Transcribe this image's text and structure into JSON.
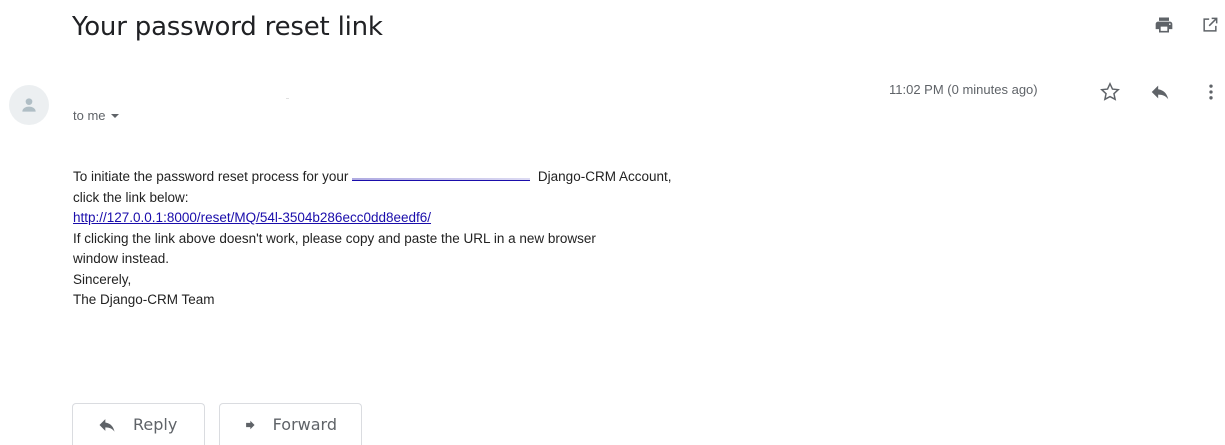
{
  "email": {
    "subject": "Your password reset link",
    "timestamp": "11:02 PM (0 minutes ago)",
    "recipient_label": "to me",
    "body": {
      "line1_before": "To initiate the password reset process for your",
      "line1_after": "Django-CRM Account,",
      "line2": "click the link below:",
      "reset_link": "http://127.0.0.1:8000/reset/MQ/54l-3504b286ecc0dd8eedf6/",
      "line4": "If clicking the link above doesn't work, please copy and paste the URL in a new browser",
      "line5": "window instead.",
      "line6": "Sincerely,",
      "line7": "The Django-CRM Team"
    }
  },
  "actions": {
    "reply_label": "Reply",
    "forward_label": "Forward"
  },
  "icons": {
    "print": "print-icon",
    "open_new_window": "open-in-new-window-icon",
    "star": "star-icon",
    "reply": "reply-icon",
    "more": "more-vert-icon",
    "avatar": "person-icon",
    "dropdown": "caret-down-icon",
    "forward": "forward-arrow-icon"
  },
  "colors": {
    "link": "#1a0dab",
    "muted": "#5f6368",
    "text": "#202124",
    "border": "#dadce0"
  }
}
